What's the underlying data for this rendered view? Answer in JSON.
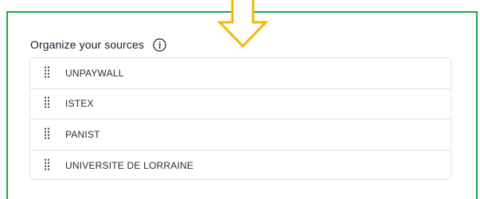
{
  "section": {
    "title": "Organize your sources",
    "info_icon": "info-icon",
    "sources": [
      {
        "label": "UNPAYWALL",
        "icon": "drag-handle-icon"
      },
      {
        "label": "ISTEX",
        "icon": "drag-handle-icon"
      },
      {
        "label": "PANIST",
        "icon": "drag-handle-icon"
      },
      {
        "label": "UNIVERSITE DE LORRAINE",
        "icon": "drag-handle-icon"
      }
    ]
  },
  "colors": {
    "frame_border": "#19a84b",
    "arrow": "#f5b800",
    "list_border": "#e1e3e8",
    "text": "#2a2d3a"
  }
}
